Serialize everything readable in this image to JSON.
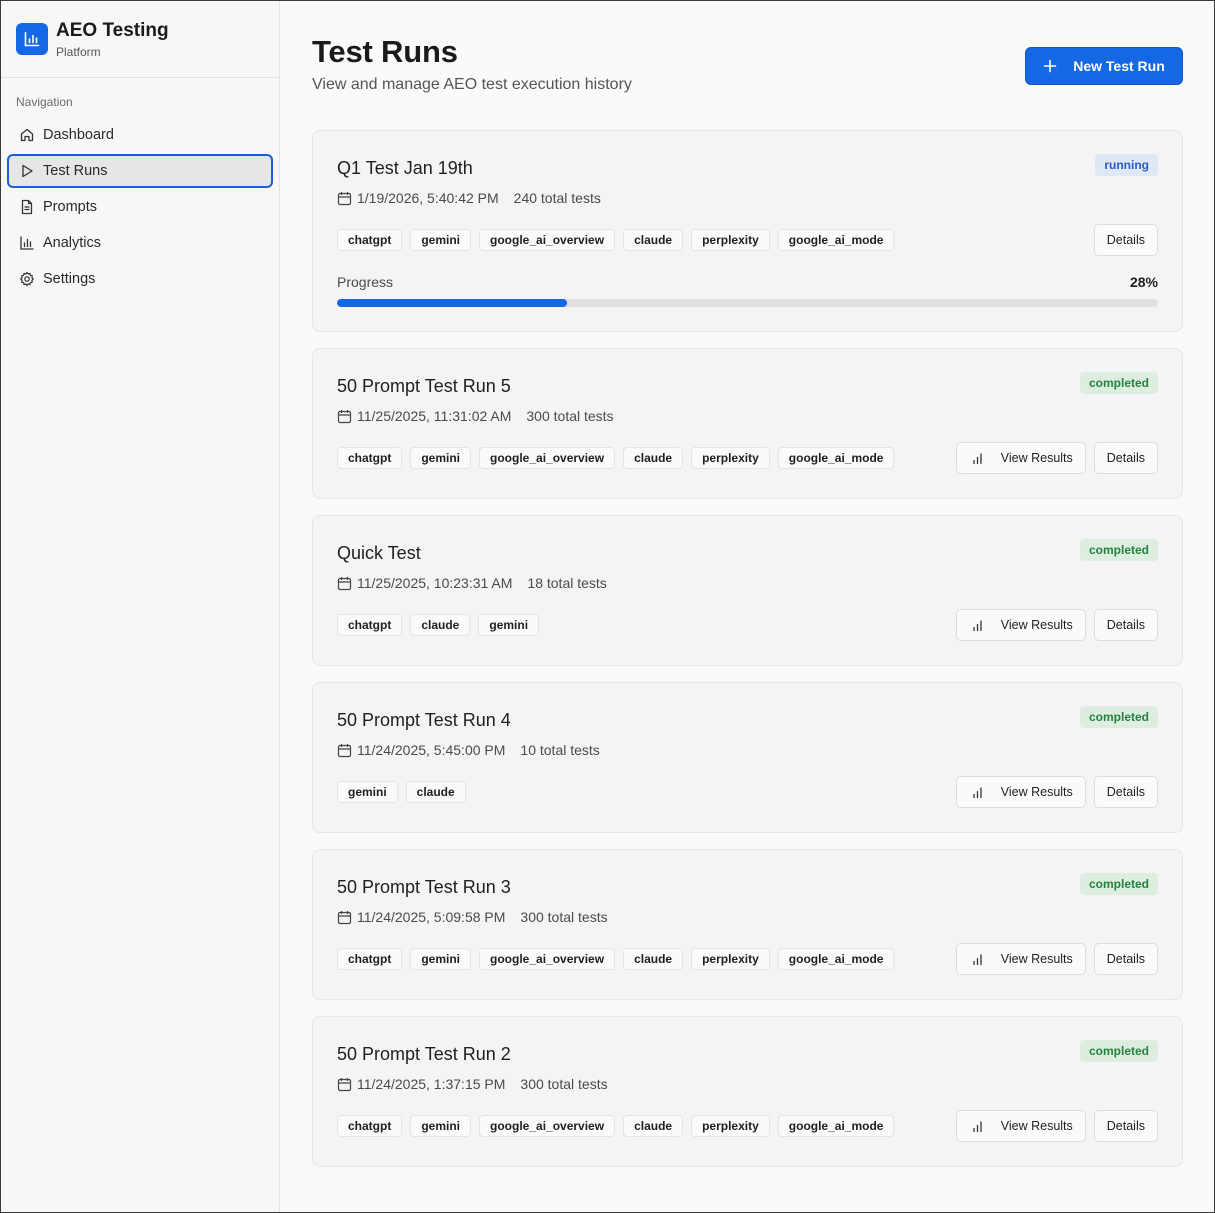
{
  "brand": {
    "title": "AEO Testing",
    "subtitle": "Platform",
    "accent": "#1468e6"
  },
  "sidebar": {
    "section_label": "Navigation",
    "items": [
      {
        "label": "Dashboard",
        "icon": "home-icon"
      },
      {
        "label": "Test Runs",
        "icon": "play-icon",
        "active": true
      },
      {
        "label": "Prompts",
        "icon": "document-icon"
      },
      {
        "label": "Analytics",
        "icon": "bar-chart-icon"
      },
      {
        "label": "Settings",
        "icon": "gear-icon"
      }
    ]
  },
  "header": {
    "title": "Test Runs",
    "subtitle": "View and manage AEO test execution history",
    "new_button_label": "New Test Run"
  },
  "labels": {
    "view_results": "View Results",
    "details": "Details",
    "progress": "Progress"
  },
  "runs": [
    {
      "title": "Q1 Test Jan 19th",
      "date": "1/19/2026, 5:40:42 PM",
      "total": "240 total tests",
      "status": "running",
      "tags": [
        "chatgpt",
        "gemini",
        "google_ai_overview",
        "claude",
        "perplexity",
        "google_ai_mode"
      ],
      "progress": 28,
      "progress_label": "28%"
    },
    {
      "title": "50 Prompt Test Run 5",
      "date": "11/25/2025, 11:31:02 AM",
      "total": "300 total tests",
      "status": "completed",
      "tags": [
        "chatgpt",
        "gemini",
        "google_ai_overview",
        "claude",
        "perplexity",
        "google_ai_mode"
      ]
    },
    {
      "title": "Quick Test",
      "date": "11/25/2025, 10:23:31 AM",
      "total": "18 total tests",
      "status": "completed",
      "tags": [
        "chatgpt",
        "claude",
        "gemini"
      ]
    },
    {
      "title": "50 Prompt Test Run 4",
      "date": "11/24/2025, 5:45:00 PM",
      "total": "10 total tests",
      "status": "completed",
      "tags": [
        "gemini",
        "claude"
      ]
    },
    {
      "title": "50 Prompt Test Run 3",
      "date": "11/24/2025, 5:09:58 PM",
      "total": "300 total tests",
      "status": "completed",
      "tags": [
        "chatgpt",
        "gemini",
        "google_ai_overview",
        "claude",
        "perplexity",
        "google_ai_mode"
      ]
    },
    {
      "title": "50 Prompt Test Run 2",
      "date": "11/24/2025, 1:37:15 PM",
      "total": "300 total tests",
      "status": "completed",
      "tags": [
        "chatgpt",
        "gemini",
        "google_ai_overview",
        "claude",
        "perplexity",
        "google_ai_mode"
      ]
    }
  ]
}
